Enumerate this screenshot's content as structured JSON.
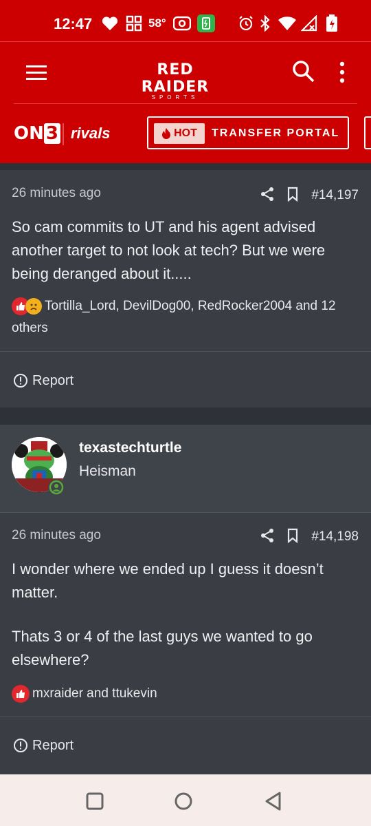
{
  "status_bar": {
    "time": "12:47",
    "temperature": "58°"
  },
  "header": {
    "logo_main": "RED RAIDER",
    "logo_sub": "SPORTS"
  },
  "subnav": {
    "on3_prefix": "ON",
    "on3_suffix": "3",
    "rivals": "rivals",
    "hot_label": "HOT",
    "portal_label": "TRANSFER PORTAL"
  },
  "posts": [
    {
      "time": "26 minutes ago",
      "number": "#14,197",
      "body": "So cam commits to UT and his agent advised another target to not look at tech? But we were being deranged about it.....",
      "reactions": "Tortilla_Lord, DevilDog00, RedRocker2004 and 12 others",
      "report_label": "Report"
    },
    {
      "author": "texastechturtle",
      "author_title": "Heisman",
      "time": "26 minutes ago",
      "number": "#14,198",
      "body_p1": "I wonder where we ended up I guess it doesn’t matter.",
      "body_p2": "Thats 3 or 4 of the last guys we wanted to go elsewhere?",
      "reactions": "mxraider and ttukevin",
      "report_label": "Report"
    }
  ],
  "colors": {
    "brand_red": "#cc0000",
    "background": "#3a3d44",
    "like_red": "#e0282e"
  }
}
